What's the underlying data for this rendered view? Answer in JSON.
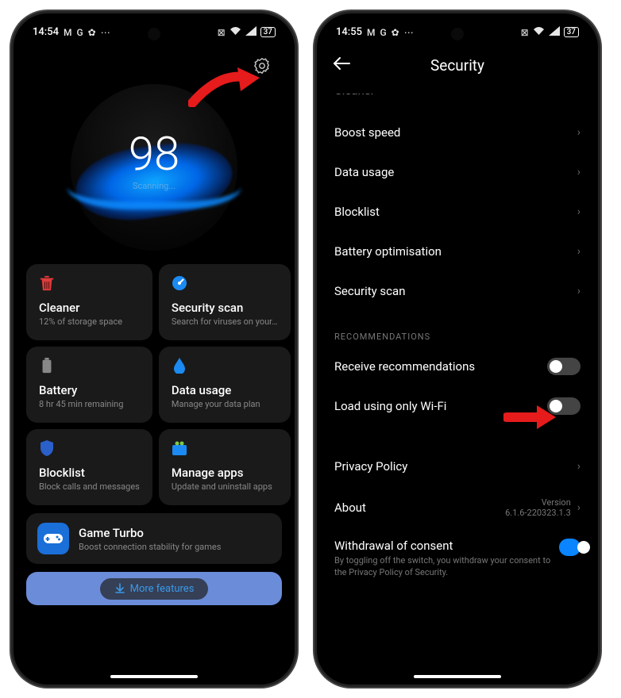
{
  "status": {
    "time1": "14:54",
    "time2": "14:55",
    "gmail_glyph": "M",
    "google_glyph": "G",
    "gear_glyph": "✿",
    "more_glyph": "⋯",
    "signal_glyph": "▲",
    "wifi_glyph": "⊚",
    "close_box": "⊠",
    "battery": "37"
  },
  "screen1": {
    "score": "98",
    "scanning": "Scanning...",
    "tiles": [
      {
        "title": "Cleaner",
        "sub": "12% of storage space",
        "icon": "trash"
      },
      {
        "title": "Security scan",
        "sub": "Search for viruses on your…",
        "icon": "gauge"
      },
      {
        "title": "Battery",
        "sub": "8 hr 45 min  remaining",
        "icon": "battery"
      },
      {
        "title": "Data usage",
        "sub": "Manage your data plan",
        "icon": "drop"
      },
      {
        "title": "Blocklist",
        "sub": "Block calls and messages",
        "icon": "shield"
      },
      {
        "title": "Manage apps",
        "sub": "Update and uninstall apps",
        "icon": "apps"
      }
    ],
    "game_turbo": {
      "title": "Game Turbo",
      "sub": "Boost connection stability for games"
    },
    "more_features": "More features"
  },
  "screen2": {
    "header": "Security",
    "cut_item": "Cleaner",
    "items": [
      "Boost speed",
      "Data usage",
      "Blocklist",
      "Battery optimisation",
      "Security scan"
    ],
    "section": "RECOMMENDATIONS",
    "toggles": [
      {
        "label": "Receive recommendations",
        "on": false
      },
      {
        "label": "Load using only Wi-Fi",
        "on": false
      }
    ],
    "privacy": "Privacy Policy",
    "about": {
      "label": "About",
      "version_label": "Version",
      "version": "6.1.6-220323.1.3"
    },
    "consent": {
      "title": "Withdrawal of consent",
      "sub": "By toggling off the switch, you withdraw your consent to the Privacy Policy of Security.",
      "on": true
    }
  }
}
